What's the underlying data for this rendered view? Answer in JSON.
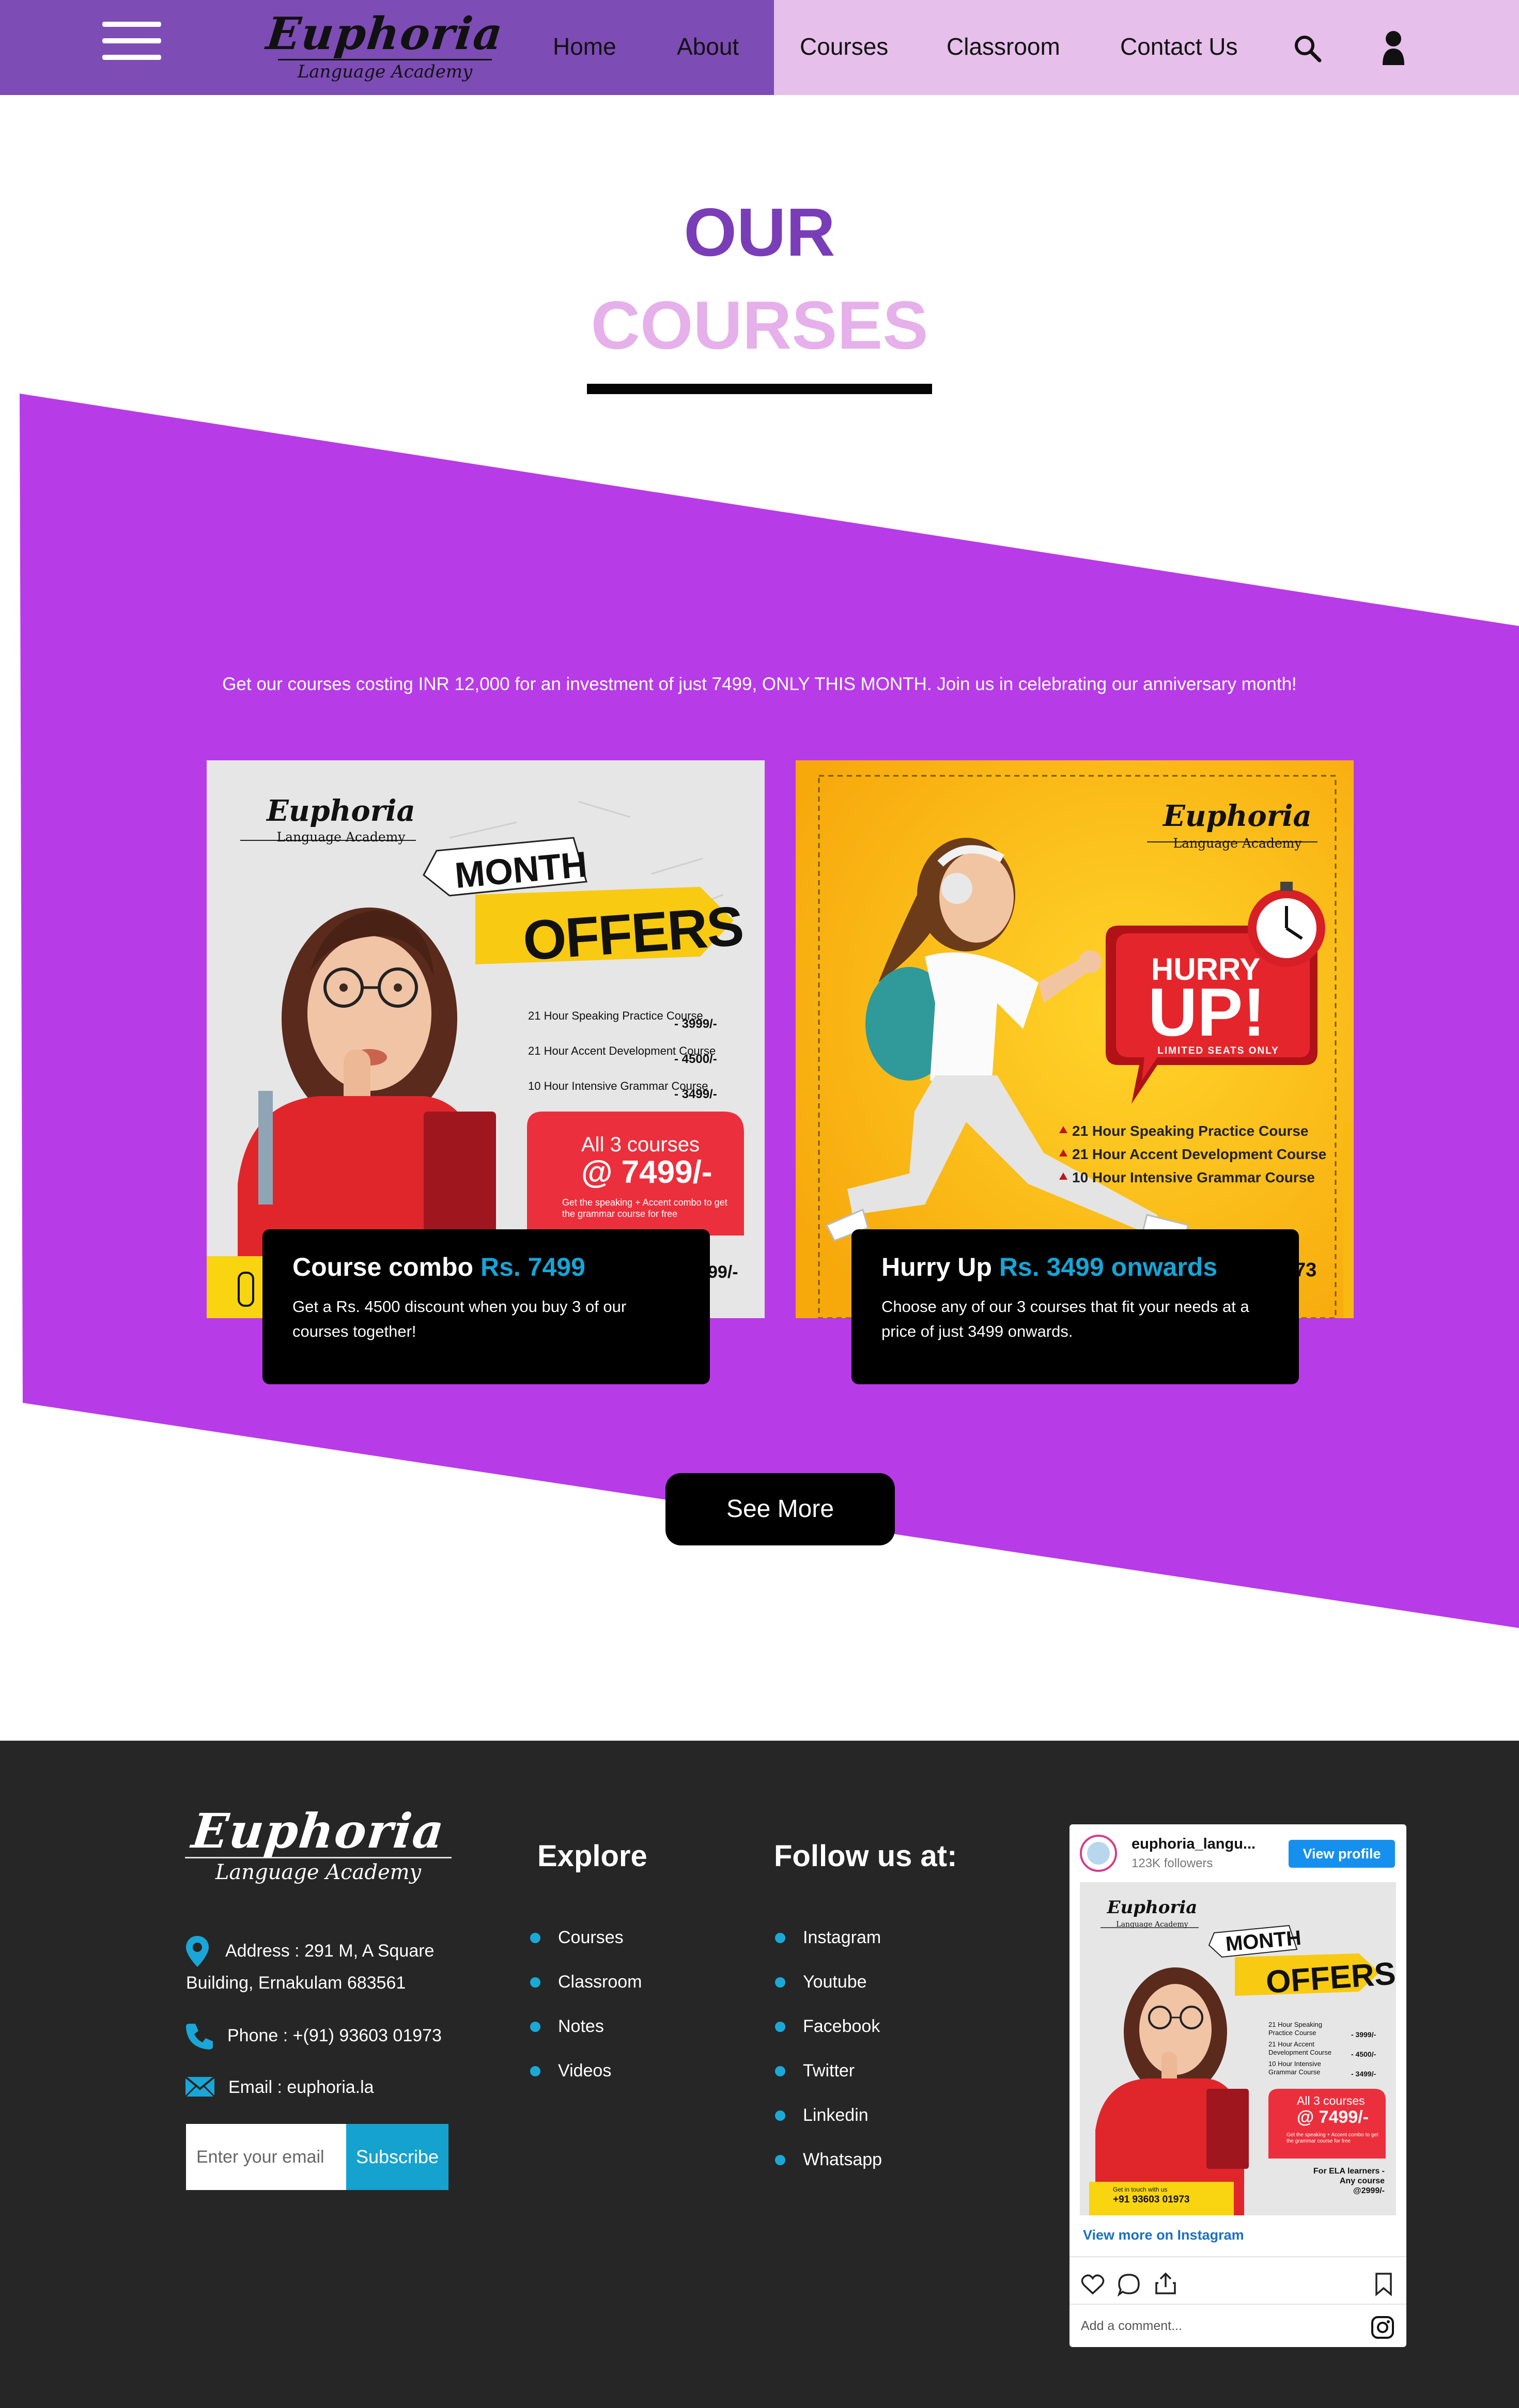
{
  "nav": {
    "brand": "Euphoria",
    "brand_sub": "Language Academy",
    "links": [
      "Home",
      "About",
      "Courses",
      "Classroom",
      "Contact Us"
    ]
  },
  "heading": {
    "line1": "OUR",
    "line2": "COURSES"
  },
  "promo_text": "Get our courses costing INR 12,000 for an investment of just 7499, ONLY THIS MONTH. Join us in celebrating our anniversary month!",
  "cards": [
    {
      "title": "Course combo",
      "price": "Rs. 7499",
      "description": "Get a Rs. 4500 discount when you buy 3 of our courses together!",
      "poster": {
        "brand": "Euphoria",
        "brand_sub": "Language Academy",
        "tag1": "MONTH",
        "tag2": "OFFERS",
        "courses": [
          {
            "name": "21 Hour Speaking Practice Course",
            "price": "- 3999/-"
          },
          {
            "name": "21 Hour Accent Development Course",
            "price": "- 4500/-"
          },
          {
            "name": "10 Hour Intensive Grammar Course",
            "price": "- 3499/-"
          }
        ],
        "deal_line1": "All 3 courses",
        "deal_line2": "@ 7499/-",
        "deal_note": "Get the speaking + Accent combo to get the grammar course for free",
        "footer_price": "99/-"
      }
    },
    {
      "title": "Hurry Up",
      "price": "Rs. 3499 onwards",
      "description": "Choose any of our 3 courses that fit your needs at a price of just 3499 onwards.",
      "poster": {
        "brand": "Euphoria",
        "brand_sub": "Language Academy",
        "badge_line1": "HURRY",
        "badge_line2": "UP!",
        "badge_line3": "LIMITED SEATS ONLY",
        "courses": [
          "21 Hour Speaking Practice Course",
          "21 Hour Accent Development Course",
          "10 Hour Intensive Grammar Course"
        ],
        "footer_partial": "73"
      }
    }
  ],
  "see_more": "See More",
  "footer": {
    "brand": "Euphoria",
    "brand_sub": "Language Academy",
    "address_line1": "Address : 291 M, A Square",
    "address_line2": "Building, Ernakulam 683561",
    "phone": "Phone : +(91) 93603 01973",
    "email": "Email : euphoria.la",
    "email_placeholder": "Enter your email",
    "subscribe": "Subscribe",
    "explore_title": "Explore",
    "explore": [
      "Courses",
      "Classroom",
      "Notes",
      "Videos"
    ],
    "follow_title": "Follow us at:",
    "follow": [
      "Instagram",
      "Youtube",
      "Facebook",
      "Twitter",
      "Linkedin",
      "Whatsapp"
    ]
  },
  "instagram": {
    "handle": "euphoria_langu...",
    "followers": "123K followers",
    "view_profile": "View profile",
    "view_more": "View more on Instagram",
    "add_comment": "Add a comment...",
    "post": {
      "brand": "Euphoria",
      "brand_sub": "Language Academy",
      "tag1": "MONTH",
      "tag2": "OFFERS",
      "courses": [
        {
          "name": "21 Hour Speaking Practice Course",
          "price": "- 3999/-"
        },
        {
          "name": "21 Hour Accent Development Course",
          "price": "- 4500/-"
        },
        {
          "name": "10 Hour Intensive Grammar Course",
          "price": "- 3499/-"
        }
      ],
      "deal_line1": "All 3 courses",
      "deal_line2": "@ 7499/-",
      "deal_note": "Get the speaking + Accent combo to get the grammar course for free",
      "learners": "For ELA learners -",
      "learners_price": "Any course @2999/-",
      "contact_label": "Get in touch with us",
      "contact_phone": "+91 93603 01973"
    }
  },
  "colors": {
    "nav_left": "#7d4cb5",
    "nav_right": "#e6bfea",
    "heading_our": "#7a3db8",
    "heading_courses": "#e6b0ea",
    "band": "#b83be8",
    "accent": "#15a5d6",
    "footer_bg": "#262626"
  },
  "icons": [
    "menu-icon",
    "search-icon",
    "user-icon",
    "location-icon",
    "phone-icon",
    "email-icon",
    "heart-icon",
    "comment-icon",
    "share-icon",
    "bookmark-icon",
    "instagram-icon",
    "alarm-clock-icon"
  ]
}
